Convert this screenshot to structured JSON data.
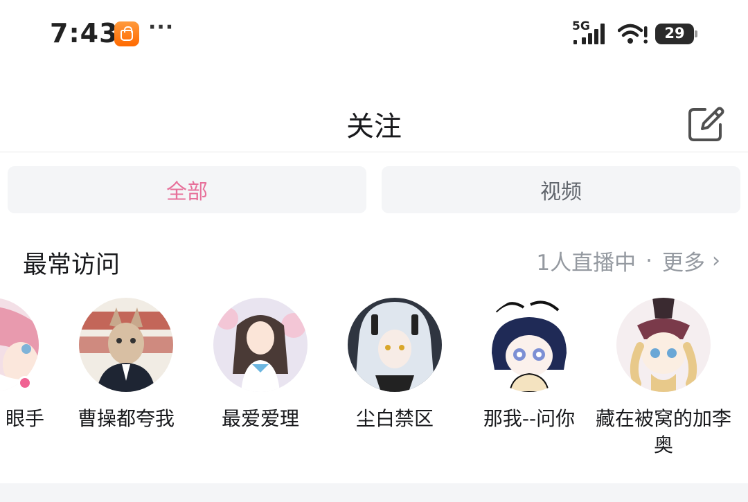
{
  "status_bar": {
    "time": "7:43",
    "network": "5G",
    "battery": "29",
    "app_icon": "mi-store-icon",
    "more_indicator": "···"
  },
  "header": {
    "title": "关注",
    "edit_icon": "edit-icon"
  },
  "tabs": [
    {
      "label": "全部",
      "active": true
    },
    {
      "label": "视频",
      "active": false
    }
  ],
  "section": {
    "title": "最常访问",
    "live_status": "1人直播中",
    "separator": "·",
    "more_label": "更多"
  },
  "visited_users": [
    {
      "name": "眼手",
      "cropped": true,
      "live": true
    },
    {
      "name": "曹操都夸我",
      "live": false
    },
    {
      "name": "最爱爱理",
      "live": false
    },
    {
      "name": "尘白禁区",
      "live": false
    },
    {
      "name": "那我--问你",
      "live": false
    },
    {
      "name": "藏在被窝的加李奥",
      "live": false
    }
  ],
  "colors": {
    "accent": "#e7709a",
    "tab_bg": "#f4f5f7",
    "muted_text": "#9499a0",
    "live_dot": "#f06292"
  }
}
